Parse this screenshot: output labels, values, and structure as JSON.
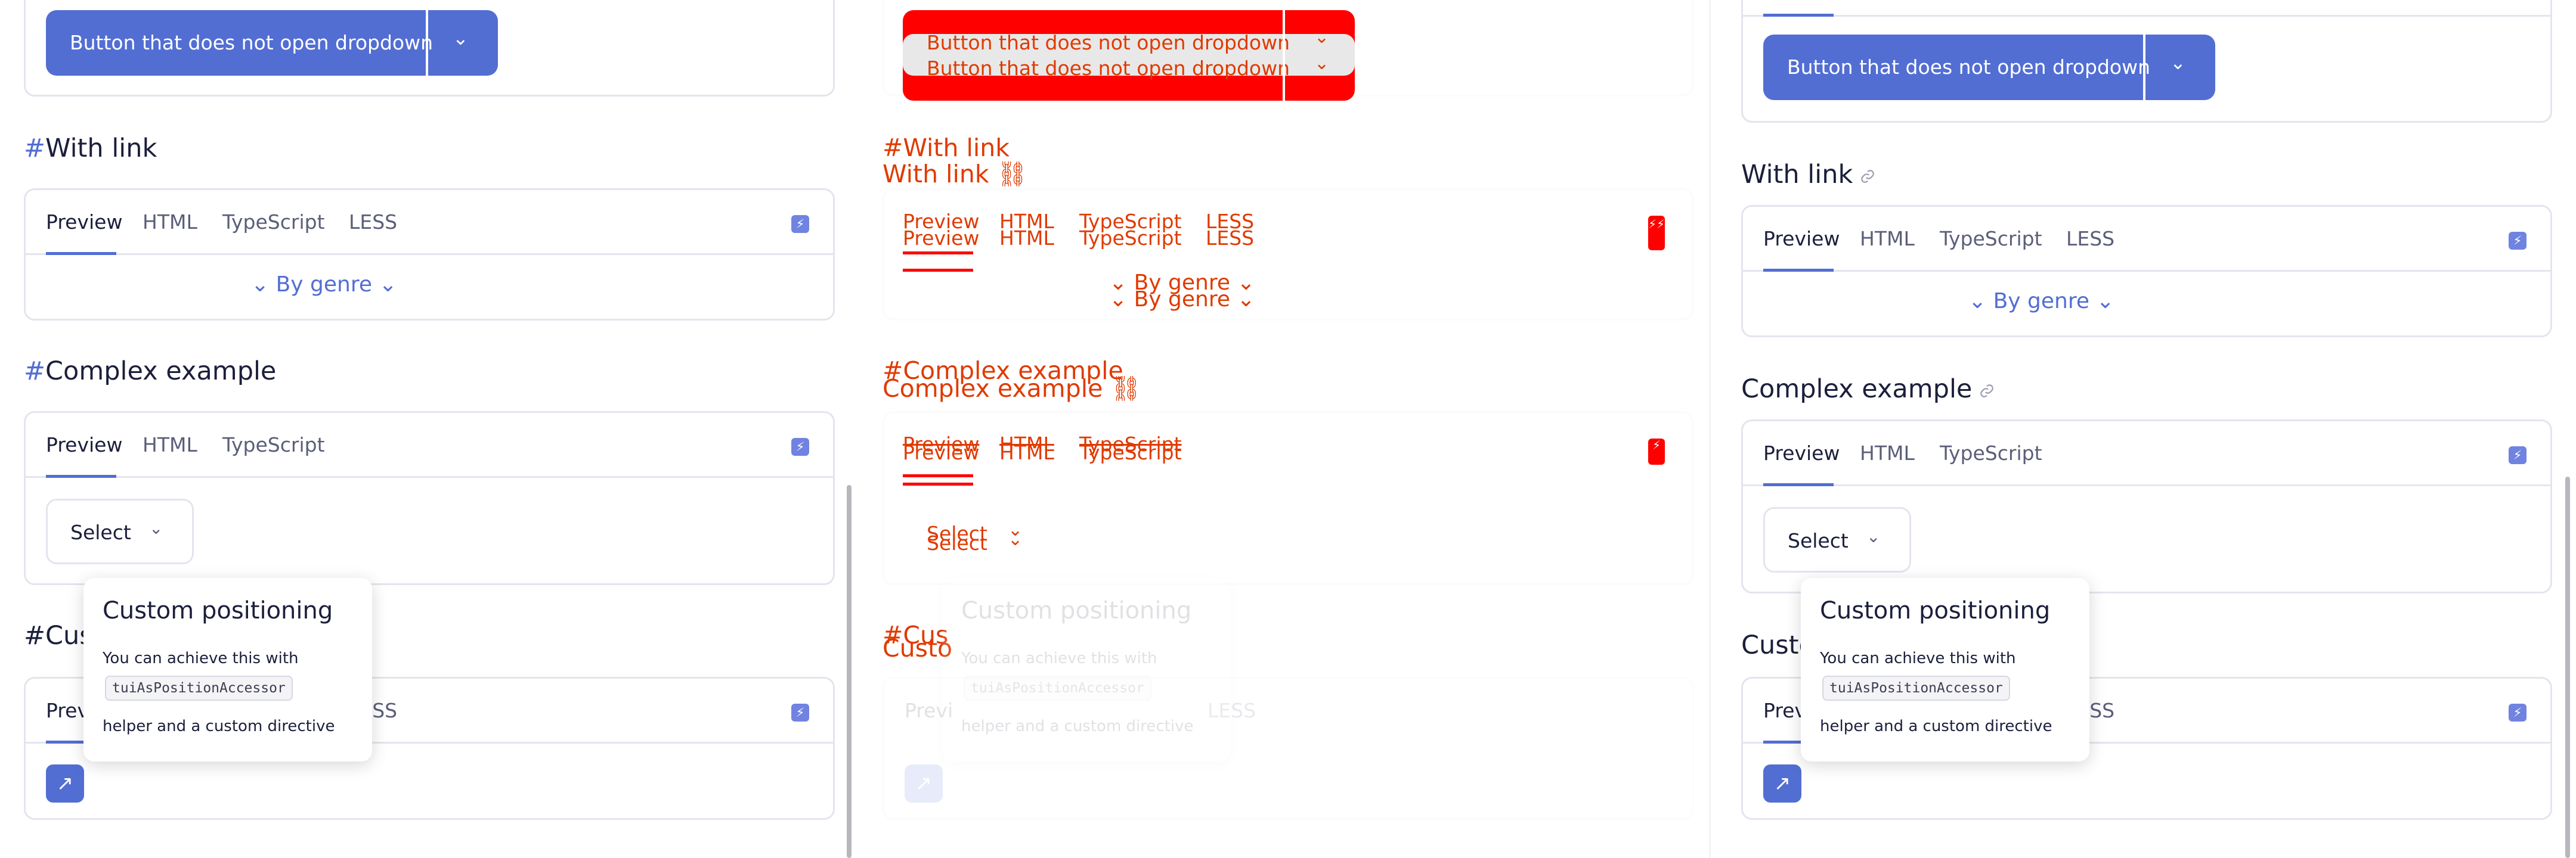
{
  "colors": {
    "accent": "#526ed3",
    "diff_red": "#ff0000",
    "diff_text": "#e03a00"
  },
  "dropdown_button": {
    "label": "Button that does not open dropdown",
    "chevron_icon": "chevron-down-icon"
  },
  "sections": {
    "with_link": {
      "hash": "#",
      "title": "With link",
      "link_icon": "link-icon"
    },
    "complex": {
      "hash": "#",
      "title": "Complex example",
      "link_icon": "link-icon"
    },
    "custom": {
      "hash": "#",
      "title": "Custom positioning"
    }
  },
  "tabs": {
    "preview": "Preview",
    "html": "HTML",
    "typescript": "TypeScript",
    "less": "LESS"
  },
  "genre": {
    "label": "By genre"
  },
  "select": {
    "label": "Select"
  },
  "popover": {
    "title": "Custom positioning",
    "line1": "You can achieve this with",
    "code": "tuiAsPositionAccessor",
    "line2": "helper and a custom directive"
  },
  "cut_heading": {
    "left": "#Cus",
    "right": "Custo",
    "mid": "#Cus",
    "mid2": "Custo"
  },
  "cut_tabs": {
    "preview": "Previ",
    "less": "LESS"
  },
  "icons": {
    "bolt": "lightning-icon",
    "arrow": "arrow-up-right-icon"
  }
}
